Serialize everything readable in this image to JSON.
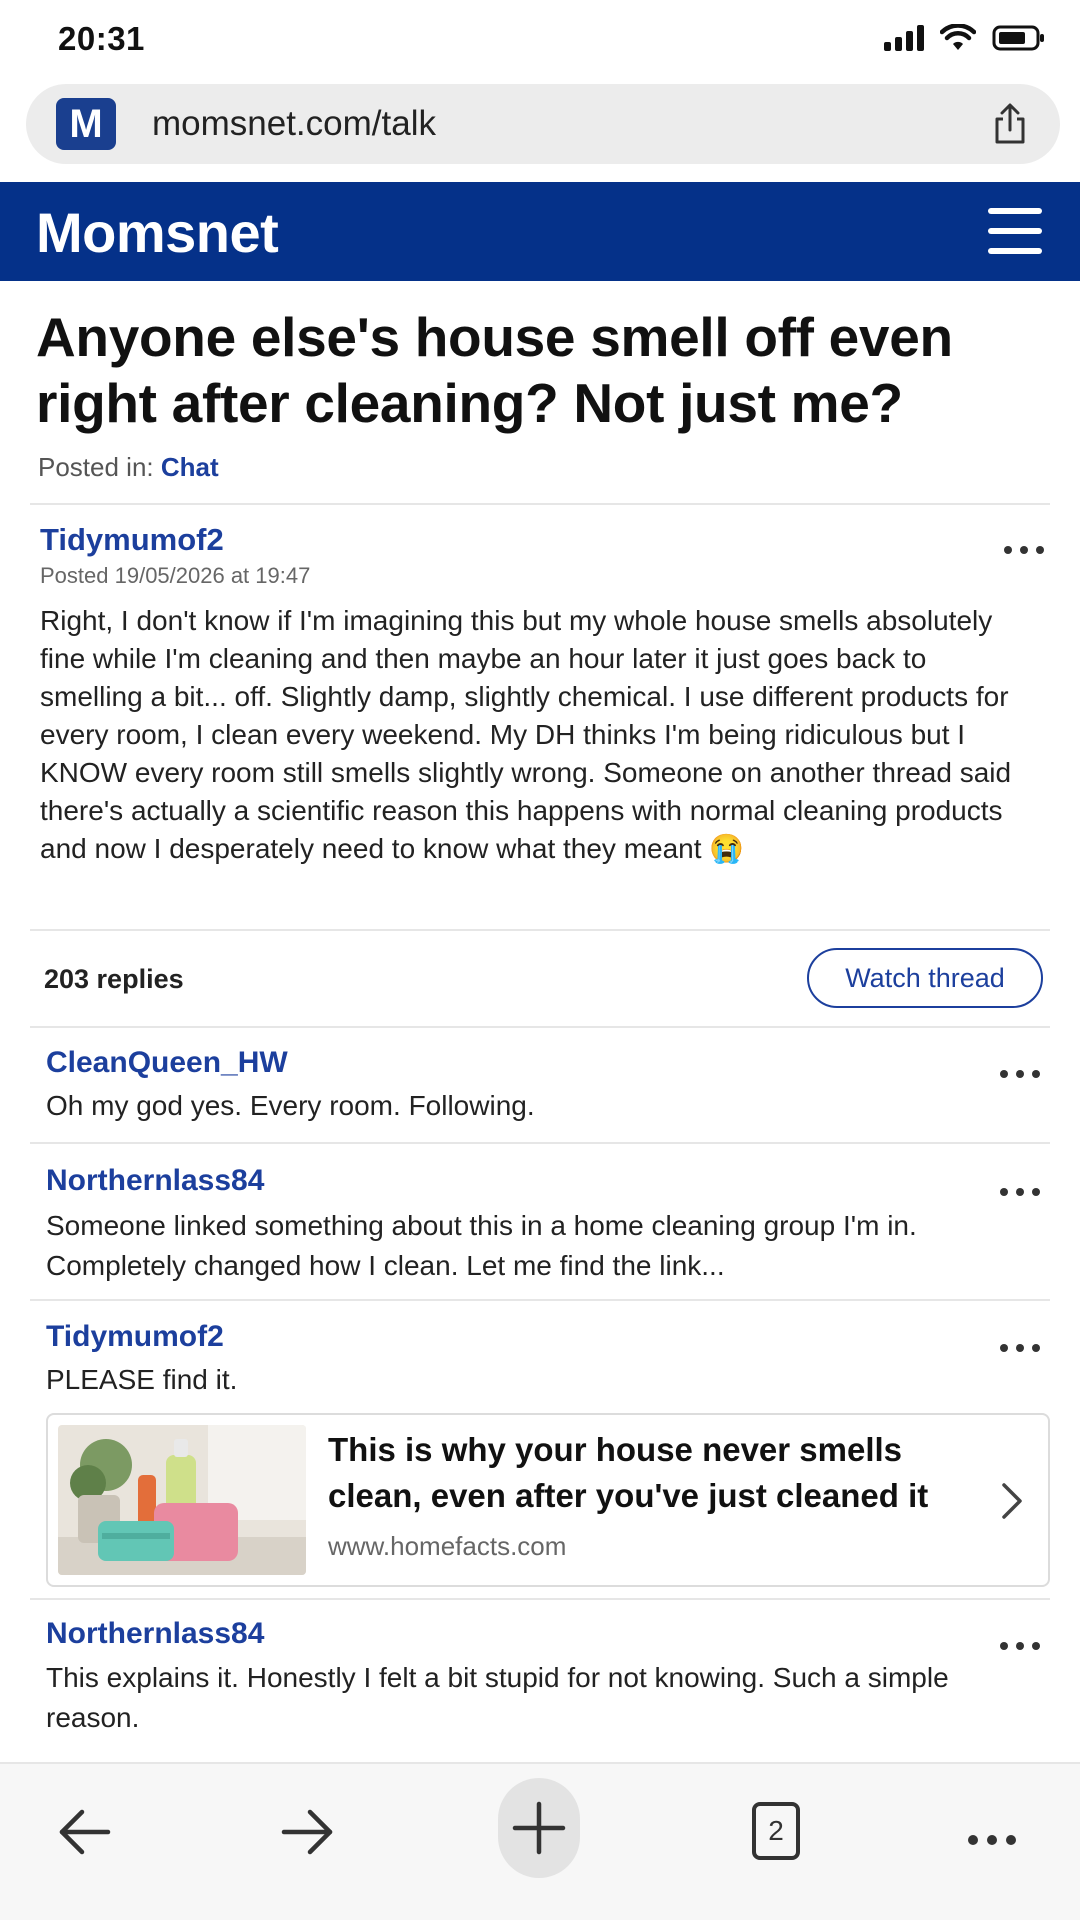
{
  "status_bar": {
    "time": "20:31"
  },
  "browser": {
    "url": "momsnet.com/talk",
    "favicon_letter": "M",
    "open_tabs": "2"
  },
  "site": {
    "logo": "Momsnet"
  },
  "thread": {
    "title": "Anyone else's house smell off even right after cleaning? Not just me?",
    "posted_in_label": "Posted in:",
    "category": "Chat",
    "op": {
      "author": "Tidymumof2",
      "date": "Posted 19/05/2026 at 19:47",
      "body": "Right, I don't know if I'm imagining this but my whole house smells absolutely fine while I'm cleaning and then maybe an hour later it just goes back to smelling a bit... off. Slightly damp, slightly chemical. I use different products for every room, I clean every weekend. My DH thinks I'm being ridiculous but I KNOW every room still smells slightly wrong. Someone on another thread said there's actually a scientific reason this happens with normal cleaning products and now I desperately need to know what they meant 😭"
    },
    "replies_count": "203 replies",
    "watch_label": "Watch thread"
  },
  "replies": [
    {
      "author": "CleanQueen_HW",
      "body": "Oh my god yes. Every room. Following."
    },
    {
      "author": "Northernlass84",
      "body": "Someone linked something about this in a home cleaning group I'm in. Completely changed how I clean. Let me find the link..."
    },
    {
      "author": "Tidymumof2",
      "body": "PLEASE find it."
    },
    {
      "author": "Northernlass84",
      "body": "This explains it. Honestly I felt a bit stupid for not knowing. Such a simple reason."
    }
  ],
  "link_card": {
    "title": "This is why your house never smells clean, even after you've just cleaned it",
    "url": "www.homefacts.com"
  },
  "colors": {
    "brand_blue": "#053189",
    "link_blue": "#1c3f9d"
  },
  "icons": [
    "signal-icon",
    "wifi-icon",
    "battery-icon",
    "share-icon",
    "hamburger-menu-icon",
    "more-options-icon",
    "chevron-right-icon",
    "back-arrow-icon",
    "forward-arrow-icon",
    "plus-icon",
    "tabs-icon"
  ]
}
